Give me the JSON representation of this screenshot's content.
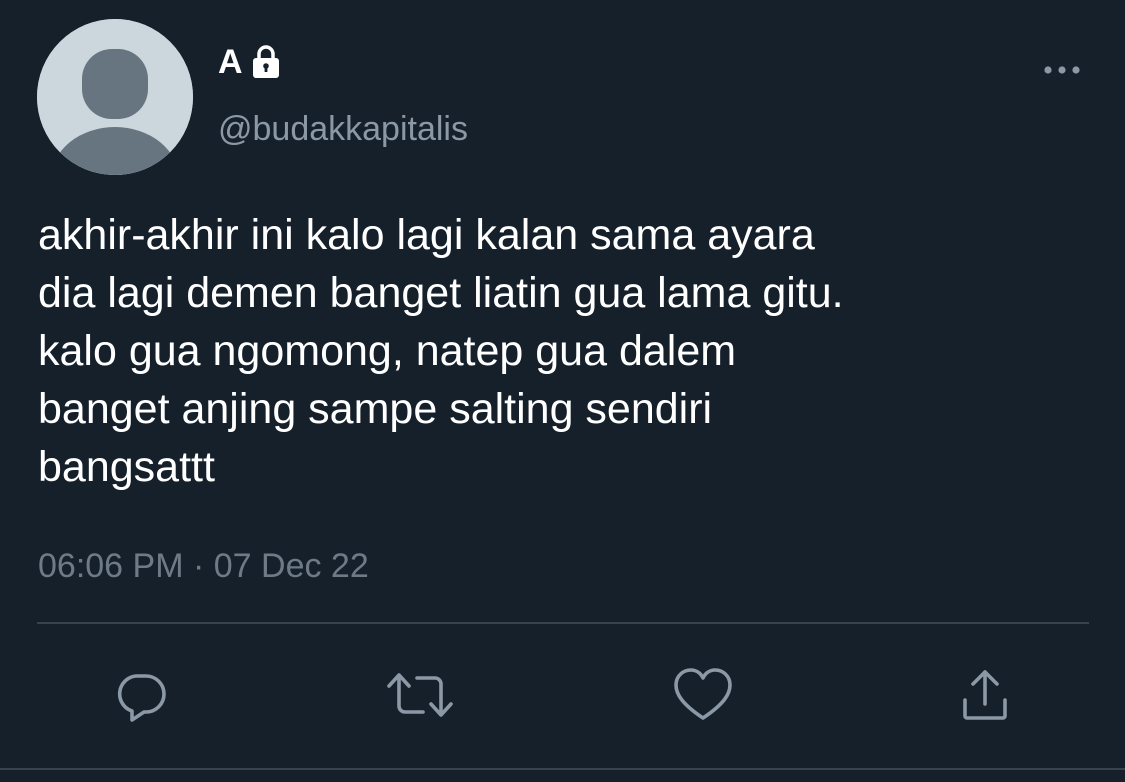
{
  "user": {
    "display_name": "A",
    "handle": "@budakkapitalis",
    "protected_icon": "lock-icon",
    "avatar_icon": "default-avatar-icon"
  },
  "tweet": {
    "lines": [
      "akhir-akhir ini kalo lagi kalan sama ayara",
      "dia lagi demen banget liatin gua lama gitu.",
      "kalo gua ngomong, natep gua dalem",
      "banget anjing sampe salting sendiri",
      "bangsattt"
    ],
    "timestamp": "06:06 PM · 07 Dec 22"
  },
  "actions": [
    {
      "icon": "reply-icon"
    },
    {
      "icon": "retweet-icon"
    },
    {
      "icon": "like-icon"
    },
    {
      "icon": "share-icon"
    }
  ],
  "menu_icon": "more-options-icon",
  "colors": {
    "background": "#15202b",
    "text": "#ffffff",
    "secondary_text": "#8b98a5",
    "timestamp_text": "#6e7b87",
    "icon": "#8b98a5",
    "divider": "#38444d",
    "avatar_bg": "#ccd6dd",
    "avatar_fg": "#66757f"
  }
}
